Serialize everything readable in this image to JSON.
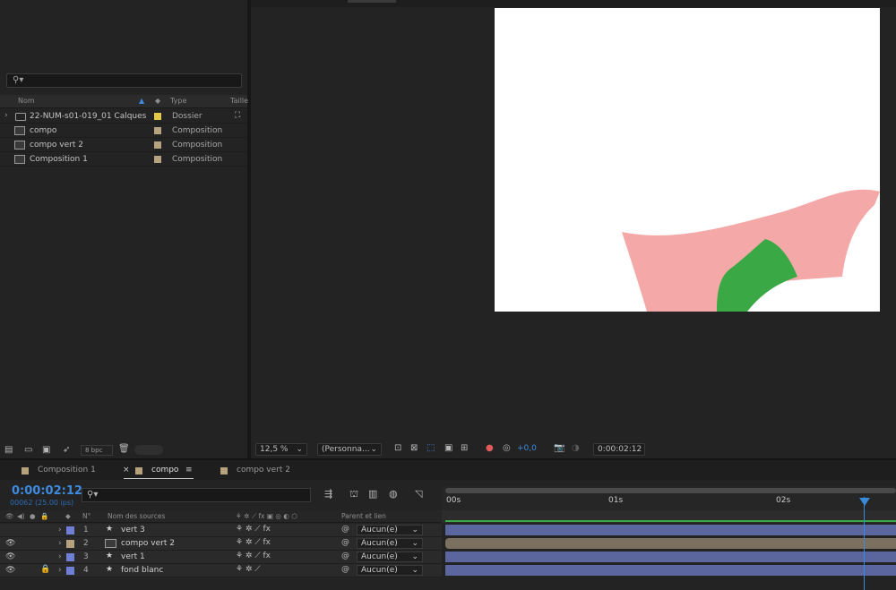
{
  "project": {
    "search_icon": "search-icon",
    "columns": {
      "name": "Nom",
      "type": "Type",
      "size": "Taille"
    },
    "items": [
      {
        "name": "22-NUM-s01-019_01 Calques",
        "type": "Dossier",
        "swatch": "#e3c84a",
        "kind": "folder"
      },
      {
        "name": "compo",
        "type": "Composition",
        "swatch": "#b7a280",
        "kind": "comp"
      },
      {
        "name": "compo vert 2",
        "type": "Composition",
        "swatch": "#b7a280",
        "kind": "comp"
      },
      {
        "name": "Composition 1",
        "type": "Composition",
        "swatch": "#b7a280",
        "kind": "comp"
      }
    ],
    "footer": {
      "bpc": "8 bpc"
    }
  },
  "viewer": {
    "zoom": "12,5 %",
    "view": "(Personna...",
    "exposure": "+0,0",
    "timecode": "0:00:02:12"
  },
  "timeline": {
    "tabs": [
      {
        "label": "Composition 1",
        "active": false
      },
      {
        "label": "compo",
        "active": true
      },
      {
        "label": "compo vert 2",
        "active": false
      }
    ],
    "timecode": "0:00:02:12",
    "frames": "00062 (25.00 ips)",
    "headers": {
      "num": "N°",
      "source": "Nom des sources",
      "parent": "Parent et lien"
    },
    "ruler": [
      "00s",
      "01s",
      "02s"
    ],
    "layers": [
      {
        "num": "1",
        "name": "vert 3",
        "parent": "Aucun(e)",
        "color": "#6f7fd6",
        "visible": false,
        "locked": false
      },
      {
        "num": "2",
        "name": "compo vert 2",
        "parent": "Aucun(e)",
        "color": "#b7a280",
        "visible": true,
        "locked": false
      },
      {
        "num": "3",
        "name": "vert 1",
        "parent": "Aucun(e)",
        "color": "#6f7fd6",
        "visible": true,
        "locked": false
      },
      {
        "num": "4",
        "name": "fond blanc",
        "parent": "Aucun(e)",
        "color": "#6f7fd6",
        "visible": true,
        "locked": true
      }
    ],
    "playhead_fraction": 0.93
  },
  "colors": {
    "accent": "#3d8be0",
    "layer_bar": "#5b659e",
    "comp_bar": "#7b6f5f",
    "pink": "#f4a9a8",
    "green": "#3aa845"
  }
}
